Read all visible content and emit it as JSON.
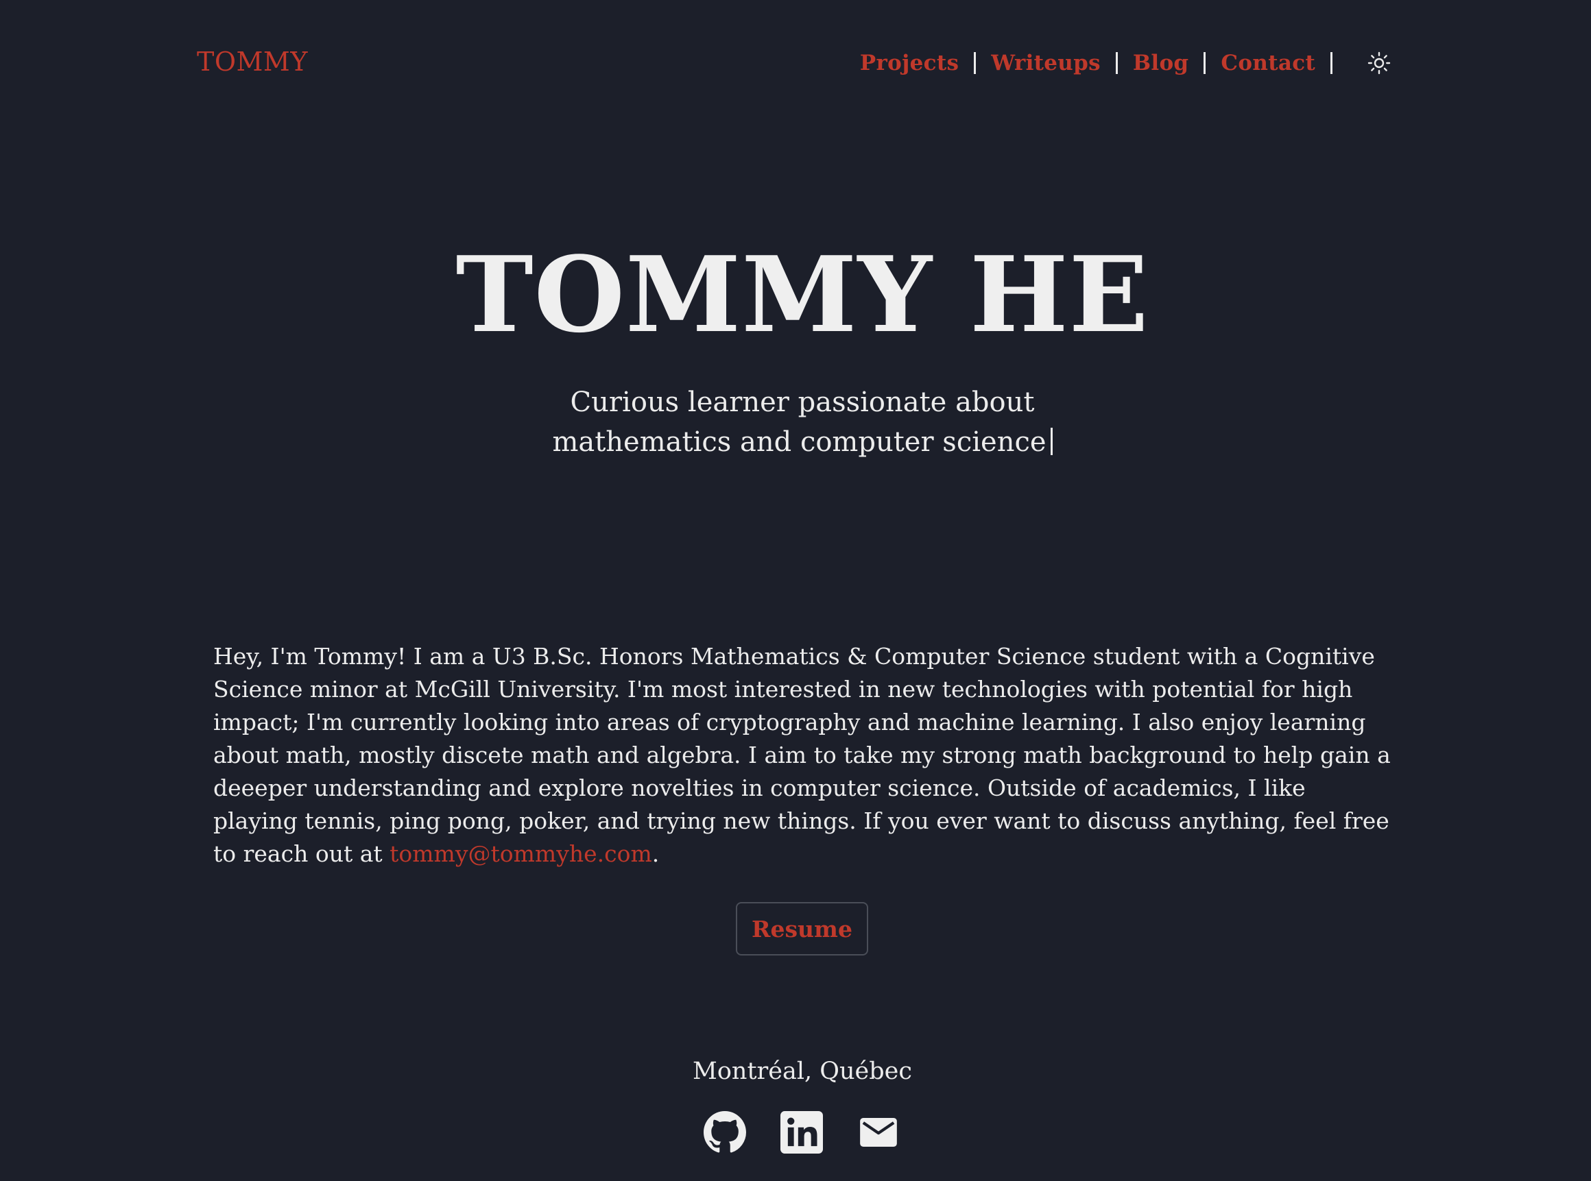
{
  "header": {
    "logo": "TOMMY",
    "nav": [
      {
        "label": "Projects"
      },
      {
        "label": "Writeups"
      },
      {
        "label": "Blog"
      },
      {
        "label": "Contact"
      }
    ],
    "theme_toggle_icon": "sun-icon"
  },
  "hero": {
    "title": "TOMMY HE",
    "tagline_line1": "Curious learner passionate about",
    "tagline_line2": "mathematics and computer science"
  },
  "bio": {
    "text": "Hey, I'm Tommy! I am a U3 B.Sc. Honors Mathematics & Computer Science student with a Cognitive Science minor at McGill University. I'm most interested in new technologies with potential for high impact; I'm currently looking into areas of cryptography and machine learning. I also enjoy learning about math, mostly discete math and algebra. I aim to take my strong math background to help gain a deeeper understanding and explore novelties in computer science. Outside of academics, I like playing tennis, ping pong, poker, and trying new things. If you ever want to discuss anything, feel free to reach out at ",
    "email": "tommy@tommyhe.com",
    "end": "."
  },
  "resume_label": "Resume",
  "footer": {
    "location": "Montréal, Québec",
    "social_icons": [
      "github-icon",
      "linkedin-icon",
      "mail-icon"
    ]
  },
  "colors": {
    "background": "#1c1f2a",
    "accent": "#c0392b",
    "text": "#ececec"
  }
}
